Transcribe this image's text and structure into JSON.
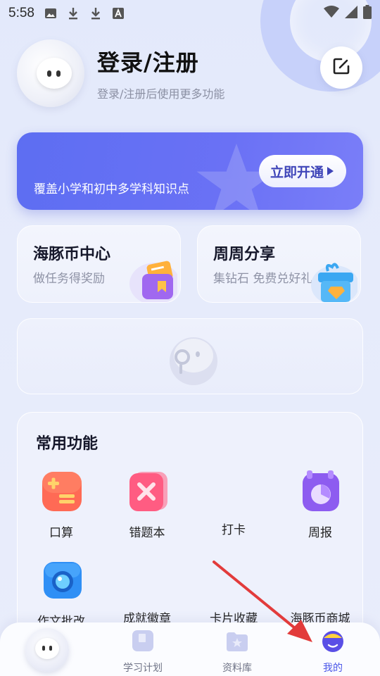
{
  "status_bar": {
    "time": "5:58"
  },
  "profile": {
    "title": "登录/注册",
    "subtitle": "登录/注册后使用更多功能"
  },
  "vip": {
    "description": "覆盖小学和初中多学科知识点",
    "button_label": "立即开通"
  },
  "tiles": [
    {
      "title": "海豚币中心",
      "subtitle": "做任务得奖励"
    },
    {
      "title": "周周分享",
      "subtitle": "集钻石 免费兑好礼"
    }
  ],
  "features": {
    "title": "常用功能",
    "items": [
      {
        "label": "口算"
      },
      {
        "label": "错题本"
      },
      {
        "label": "打卡"
      },
      {
        "label": "周报"
      },
      {
        "label": "作文批改"
      },
      {
        "label": "成就徽章"
      },
      {
        "label": "卡片收藏"
      },
      {
        "label": "海豚币商城"
      }
    ]
  },
  "tabbar": {
    "items": [
      {
        "label": "学习计划"
      },
      {
        "label": "资料库"
      },
      {
        "label": "我的"
      }
    ],
    "active_color": "#4a56e8"
  },
  "colors": {
    "accent": "#5d6ef2",
    "annotation_arrow": "#e23b3b"
  }
}
